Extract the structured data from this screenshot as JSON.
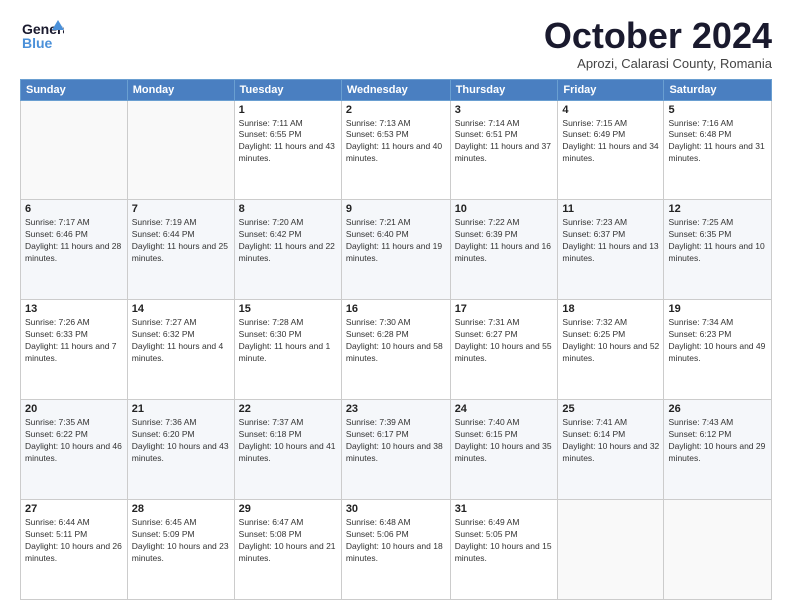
{
  "header": {
    "logo_line1": "General",
    "logo_line2": "Blue",
    "month_title": "October 2024",
    "subtitle": "Aprozi, Calarasi County, Romania"
  },
  "weekdays": [
    "Sunday",
    "Monday",
    "Tuesday",
    "Wednesday",
    "Thursday",
    "Friday",
    "Saturday"
  ],
  "weeks": [
    [
      {
        "day": "",
        "sunrise": "",
        "sunset": "",
        "daylight": ""
      },
      {
        "day": "",
        "sunrise": "",
        "sunset": "",
        "daylight": ""
      },
      {
        "day": "1",
        "sunrise": "Sunrise: 7:11 AM",
        "sunset": "Sunset: 6:55 PM",
        "daylight": "Daylight: 11 hours and 43 minutes."
      },
      {
        "day": "2",
        "sunrise": "Sunrise: 7:13 AM",
        "sunset": "Sunset: 6:53 PM",
        "daylight": "Daylight: 11 hours and 40 minutes."
      },
      {
        "day": "3",
        "sunrise": "Sunrise: 7:14 AM",
        "sunset": "Sunset: 6:51 PM",
        "daylight": "Daylight: 11 hours and 37 minutes."
      },
      {
        "day": "4",
        "sunrise": "Sunrise: 7:15 AM",
        "sunset": "Sunset: 6:49 PM",
        "daylight": "Daylight: 11 hours and 34 minutes."
      },
      {
        "day": "5",
        "sunrise": "Sunrise: 7:16 AM",
        "sunset": "Sunset: 6:48 PM",
        "daylight": "Daylight: 11 hours and 31 minutes."
      }
    ],
    [
      {
        "day": "6",
        "sunrise": "Sunrise: 7:17 AM",
        "sunset": "Sunset: 6:46 PM",
        "daylight": "Daylight: 11 hours and 28 minutes."
      },
      {
        "day": "7",
        "sunrise": "Sunrise: 7:19 AM",
        "sunset": "Sunset: 6:44 PM",
        "daylight": "Daylight: 11 hours and 25 minutes."
      },
      {
        "day": "8",
        "sunrise": "Sunrise: 7:20 AM",
        "sunset": "Sunset: 6:42 PM",
        "daylight": "Daylight: 11 hours and 22 minutes."
      },
      {
        "day": "9",
        "sunrise": "Sunrise: 7:21 AM",
        "sunset": "Sunset: 6:40 PM",
        "daylight": "Daylight: 11 hours and 19 minutes."
      },
      {
        "day": "10",
        "sunrise": "Sunrise: 7:22 AM",
        "sunset": "Sunset: 6:39 PM",
        "daylight": "Daylight: 11 hours and 16 minutes."
      },
      {
        "day": "11",
        "sunrise": "Sunrise: 7:23 AM",
        "sunset": "Sunset: 6:37 PM",
        "daylight": "Daylight: 11 hours and 13 minutes."
      },
      {
        "day": "12",
        "sunrise": "Sunrise: 7:25 AM",
        "sunset": "Sunset: 6:35 PM",
        "daylight": "Daylight: 11 hours and 10 minutes."
      }
    ],
    [
      {
        "day": "13",
        "sunrise": "Sunrise: 7:26 AM",
        "sunset": "Sunset: 6:33 PM",
        "daylight": "Daylight: 11 hours and 7 minutes."
      },
      {
        "day": "14",
        "sunrise": "Sunrise: 7:27 AM",
        "sunset": "Sunset: 6:32 PM",
        "daylight": "Daylight: 11 hours and 4 minutes."
      },
      {
        "day": "15",
        "sunrise": "Sunrise: 7:28 AM",
        "sunset": "Sunset: 6:30 PM",
        "daylight": "Daylight: 11 hours and 1 minute."
      },
      {
        "day": "16",
        "sunrise": "Sunrise: 7:30 AM",
        "sunset": "Sunset: 6:28 PM",
        "daylight": "Daylight: 10 hours and 58 minutes."
      },
      {
        "day": "17",
        "sunrise": "Sunrise: 7:31 AM",
        "sunset": "Sunset: 6:27 PM",
        "daylight": "Daylight: 10 hours and 55 minutes."
      },
      {
        "day": "18",
        "sunrise": "Sunrise: 7:32 AM",
        "sunset": "Sunset: 6:25 PM",
        "daylight": "Daylight: 10 hours and 52 minutes."
      },
      {
        "day": "19",
        "sunrise": "Sunrise: 7:34 AM",
        "sunset": "Sunset: 6:23 PM",
        "daylight": "Daylight: 10 hours and 49 minutes."
      }
    ],
    [
      {
        "day": "20",
        "sunrise": "Sunrise: 7:35 AM",
        "sunset": "Sunset: 6:22 PM",
        "daylight": "Daylight: 10 hours and 46 minutes."
      },
      {
        "day": "21",
        "sunrise": "Sunrise: 7:36 AM",
        "sunset": "Sunset: 6:20 PM",
        "daylight": "Daylight: 10 hours and 43 minutes."
      },
      {
        "day": "22",
        "sunrise": "Sunrise: 7:37 AM",
        "sunset": "Sunset: 6:18 PM",
        "daylight": "Daylight: 10 hours and 41 minutes."
      },
      {
        "day": "23",
        "sunrise": "Sunrise: 7:39 AM",
        "sunset": "Sunset: 6:17 PM",
        "daylight": "Daylight: 10 hours and 38 minutes."
      },
      {
        "day": "24",
        "sunrise": "Sunrise: 7:40 AM",
        "sunset": "Sunset: 6:15 PM",
        "daylight": "Daylight: 10 hours and 35 minutes."
      },
      {
        "day": "25",
        "sunrise": "Sunrise: 7:41 AM",
        "sunset": "Sunset: 6:14 PM",
        "daylight": "Daylight: 10 hours and 32 minutes."
      },
      {
        "day": "26",
        "sunrise": "Sunrise: 7:43 AM",
        "sunset": "Sunset: 6:12 PM",
        "daylight": "Daylight: 10 hours and 29 minutes."
      }
    ],
    [
      {
        "day": "27",
        "sunrise": "Sunrise: 6:44 AM",
        "sunset": "Sunset: 5:11 PM",
        "daylight": "Daylight: 10 hours and 26 minutes."
      },
      {
        "day": "28",
        "sunrise": "Sunrise: 6:45 AM",
        "sunset": "Sunset: 5:09 PM",
        "daylight": "Daylight: 10 hours and 23 minutes."
      },
      {
        "day": "29",
        "sunrise": "Sunrise: 6:47 AM",
        "sunset": "Sunset: 5:08 PM",
        "daylight": "Daylight: 10 hours and 21 minutes."
      },
      {
        "day": "30",
        "sunrise": "Sunrise: 6:48 AM",
        "sunset": "Sunset: 5:06 PM",
        "daylight": "Daylight: 10 hours and 18 minutes."
      },
      {
        "day": "31",
        "sunrise": "Sunrise: 6:49 AM",
        "sunset": "Sunset: 5:05 PM",
        "daylight": "Daylight: 10 hours and 15 minutes."
      },
      {
        "day": "",
        "sunrise": "",
        "sunset": "",
        "daylight": ""
      },
      {
        "day": "",
        "sunrise": "",
        "sunset": "",
        "daylight": ""
      }
    ]
  ]
}
